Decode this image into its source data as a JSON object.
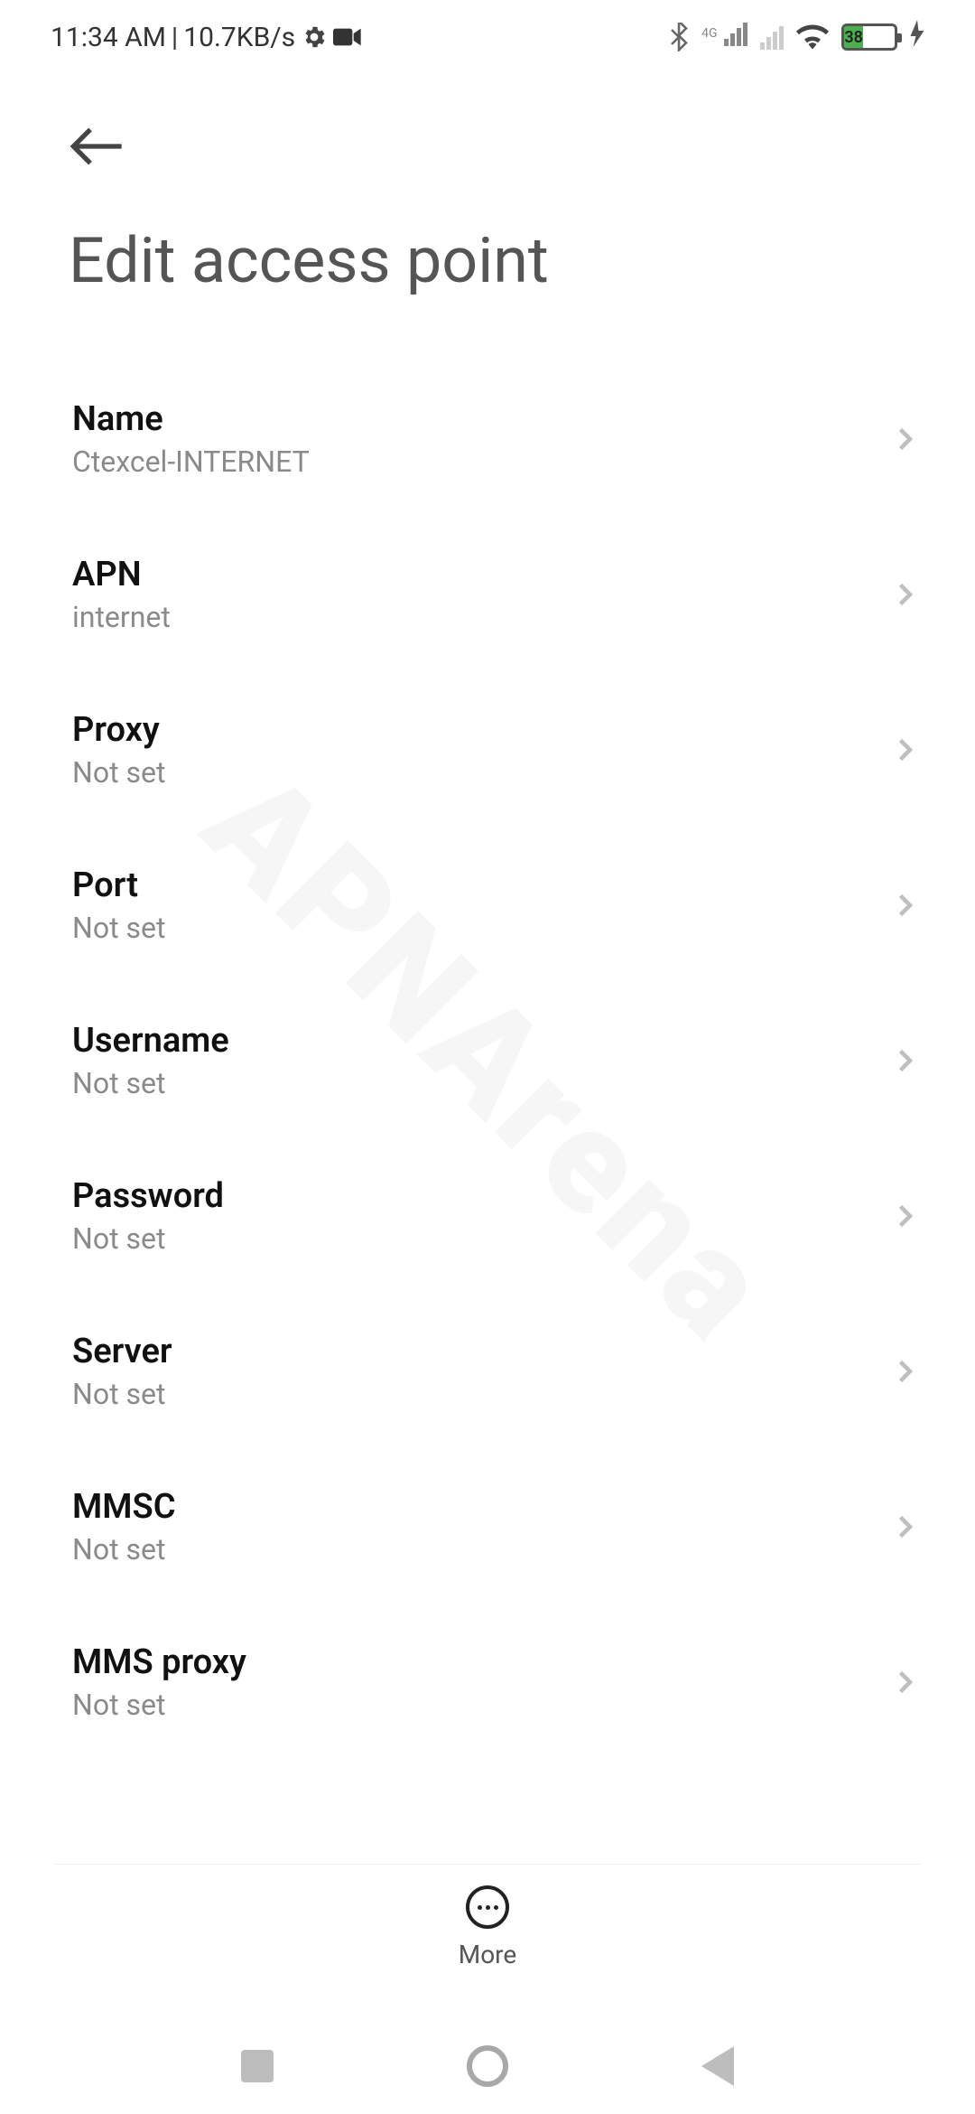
{
  "status": {
    "time": "11:34 AM",
    "separator": "|",
    "net_speed": "10.7KB/s",
    "net_type": "4G",
    "battery_pct": "38"
  },
  "header": {
    "title": "Edit access point"
  },
  "fields": [
    {
      "label": "Name",
      "value": "Ctexcel-INTERNET"
    },
    {
      "label": "APN",
      "value": "internet"
    },
    {
      "label": "Proxy",
      "value": "Not set"
    },
    {
      "label": "Port",
      "value": "Not set"
    },
    {
      "label": "Username",
      "value": "Not set"
    },
    {
      "label": "Password",
      "value": "Not set"
    },
    {
      "label": "Server",
      "value": "Not set"
    },
    {
      "label": "MMSC",
      "value": "Not set"
    },
    {
      "label": "MMS proxy",
      "value": "Not set"
    }
  ],
  "toolbar": {
    "more_label": "More"
  },
  "watermark": "APNArena"
}
